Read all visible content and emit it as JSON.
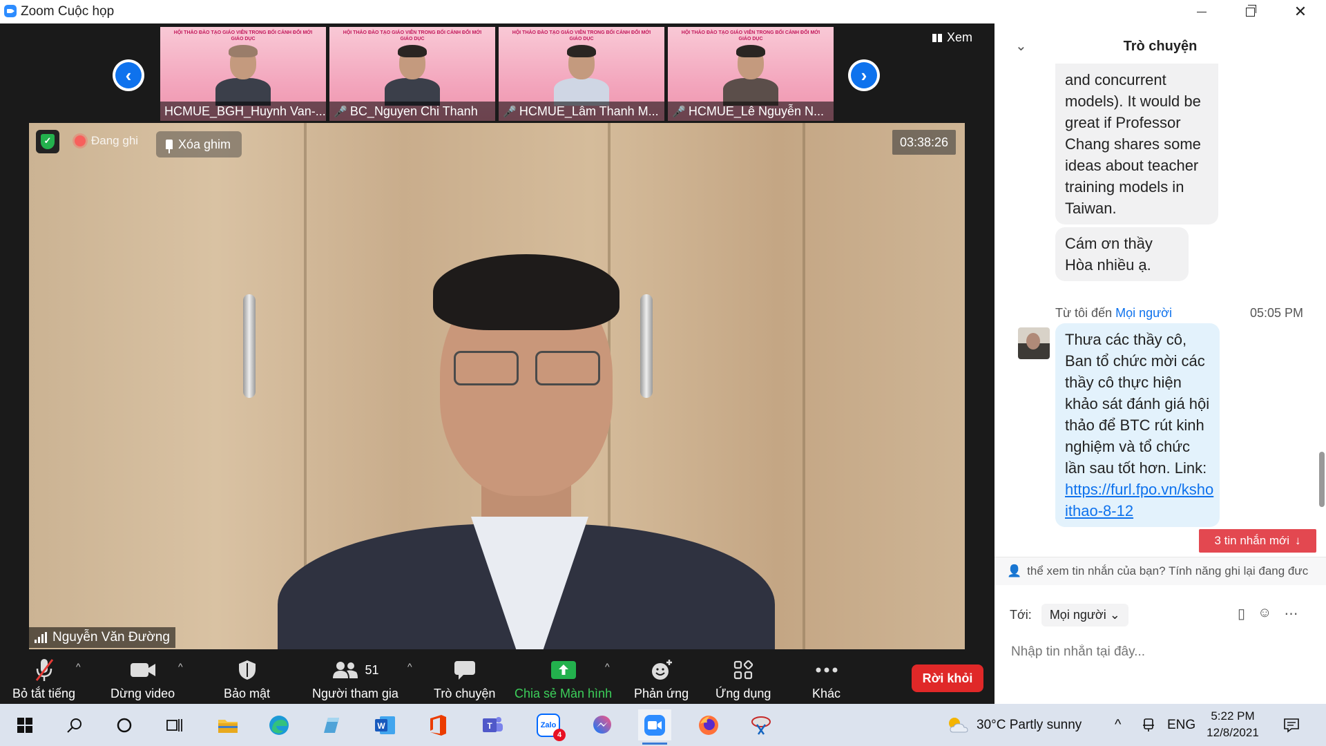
{
  "window": {
    "title": "Zoom Cuộc họp",
    "controls": [
      "minimize",
      "restore",
      "close"
    ]
  },
  "view_button": {
    "label": "Xem",
    "icon": "grid-icon"
  },
  "thumbnails": [
    {
      "name": "HCMUE_BGH_Huynh Van-...",
      "muted": false,
      "banner": "HỘI THẢO ĐÀO TẠO GIÁO VIÊN TRONG BỐI CẢNH ĐỔI MỚI GIÁO DỤC"
    },
    {
      "name": "BC_Nguyen Chi Thanh",
      "muted": true,
      "banner": "HỘI THẢO ĐÀO TẠO GIÁO VIÊN TRONG BỐI CẢNH ĐỔI MỚI GIÁO DỤC"
    },
    {
      "name": "HCMUE_Lâm Thanh M...",
      "muted": true,
      "banner": "HỘI THẢO ĐÀO TẠO GIÁO VIÊN TRONG BỐI CẢNH ĐỔI MỚI GIÁO DỤC"
    },
    {
      "name": "HCMUE_Lê Nguyễn N...",
      "muted": true,
      "banner": "HỘI THẢO ĐÀO TẠO GIÁO VIÊN TRONG BỐI CẢNH ĐỔI MỚI GIÁO DỤC"
    }
  ],
  "main_video": {
    "recording_label": "Đang ghi",
    "unpin_label": "Xóa ghim",
    "timer": "03:38:26",
    "speaker_name": "Nguyễn Văn Đường"
  },
  "toolbar": {
    "mute_label": "Bỏ tắt tiếng",
    "video_label": "Dừng video",
    "security_label": "Bảo mật",
    "participants_label": "Người tham gia",
    "participants_count": "51",
    "chat_label": "Trò chuyện",
    "share_label": "Chia sẻ Màn hình",
    "reactions_label": "Phản ứng",
    "apps_label": "Ứng dụng",
    "more_label": "Khác",
    "leave_label": "Rời khỏi"
  },
  "chat": {
    "title": "Trò chuyện",
    "messages": [
      {
        "text": "and concurrent models). It would be great if Professor Chang shares some ideas about teacher training models in Taiwan."
      },
      {
        "text": "Cám ơn thầy Hòa nhiều ạ."
      }
    ],
    "meta": {
      "from": "Từ tôi đến",
      "to": "Mọi người",
      "time": "05:05 PM"
    },
    "my_message": {
      "text": "Thưa các thầy cô, Ban tổ chức mời các thầy cô thực hiện khảo sát đánh giá hội thảo để BTC rút kinh nghiệm và tổ chức lần sau tốt hơn. Link: ",
      "link_line1": "https://furl.fpo.vn/ksho",
      "link_line2": "ithao-8-12"
    },
    "new_messages": "3 tin nhắn mới",
    "notice": "thể xem tin nhắn của bạn? Tính năng ghi lại đang đưc",
    "to_label": "Tới:",
    "recipient": "Mọi người",
    "input_placeholder": "Nhập tin nhắn tại đây..."
  },
  "taskbar": {
    "weather": "30°C  Partly sunny",
    "language": "ENG",
    "time": "5:22 PM",
    "date": "12/8/2021",
    "badge_count": "4"
  },
  "colors": {
    "accent": "#0e72ed",
    "leave": "#e02828",
    "share": "#23b14d",
    "new_msg": "#e34850"
  }
}
